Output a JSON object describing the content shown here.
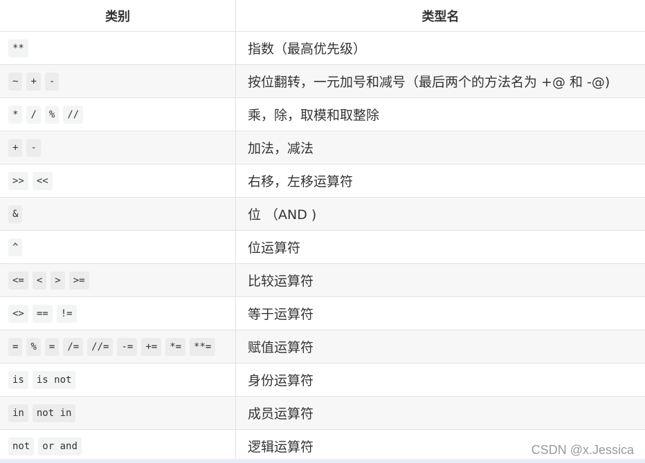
{
  "header": {
    "col1": "类别",
    "col2": "类型名"
  },
  "rows": [
    {
      "ops": [
        "**"
      ],
      "desc": "指数（最高优先级）"
    },
    {
      "ops": [
        "~",
        "+",
        "-"
      ],
      "desc": "按位翻转，一元加号和减号（最后两个的方法名为 +@ 和 -@)"
    },
    {
      "ops": [
        "*",
        "/",
        "%",
        "//"
      ],
      "desc": "乘，除，取模和取整除"
    },
    {
      "ops": [
        "+",
        "-"
      ],
      "desc": "加法，减法"
    },
    {
      "ops": [
        ">>",
        "<<"
      ],
      "desc": "右移，左移运算符"
    },
    {
      "ops": [
        "&"
      ],
      "desc": "位 （AND )"
    },
    {
      "ops": [
        "^"
      ],
      "desc": "位运算符"
    },
    {
      "ops": [
        "<=",
        "<",
        ">",
        ">="
      ],
      "desc": "比较运算符"
    },
    {
      "ops": [
        "<>",
        "==",
        "!="
      ],
      "desc": "等于运算符"
    },
    {
      "ops": [
        "=",
        "%",
        "=",
        "/=",
        "//=",
        "-=",
        "+=",
        "*=",
        "**="
      ],
      "desc": "赋值运算符"
    },
    {
      "ops": [
        "is",
        "is not"
      ],
      "desc": "身份运算符"
    },
    {
      "ops": [
        "in",
        "not in"
      ],
      "desc": "成员运算符"
    },
    {
      "ops": [
        "not",
        "or and"
      ],
      "desc": "逻辑运算符"
    }
  ],
  "watermark": "CSDN @x.Jessica"
}
